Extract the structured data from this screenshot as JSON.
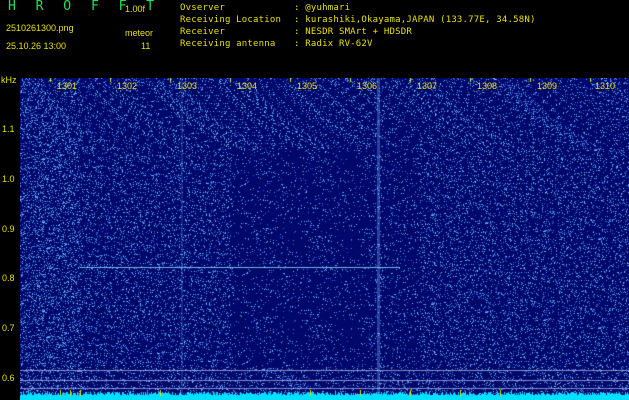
{
  "header": {
    "app_title": "H R O F F T",
    "version": "1.00f",
    "filename": "2510261300.png",
    "mode": "meteor",
    "timestamp": "25.10.26 13:00",
    "count": "11"
  },
  "info": [
    {
      "label": "Ovserver",
      "value": ": @yuhmari"
    },
    {
      "label": "Receiving Location",
      "value": ": kurashiki,Okayama,JAPAN (133.77E, 34.58N)"
    },
    {
      "label": "Receiver",
      "value": ": NESDR SMArt + HDSDR"
    },
    {
      "label": "Receiving antenna",
      "value": ": Radix RV-62V"
    }
  ],
  "axis": {
    "unit": "kHz",
    "x_labels": [
      "1301",
      "1302",
      "1303",
      "1304",
      "1305",
      "1306",
      "1307",
      "1308",
      "1309",
      "1310"
    ],
    "y_labels": [
      "1.1",
      "1.0",
      "0.9",
      "0.8",
      "0.7",
      "0.6"
    ]
  },
  "colors": {
    "background": "#000a6a",
    "text": "#e8e000",
    "title": "#22e05a",
    "noise": "#3a6cff",
    "signal": "#7fd8ff",
    "power_bar": "#00e0ff"
  }
}
